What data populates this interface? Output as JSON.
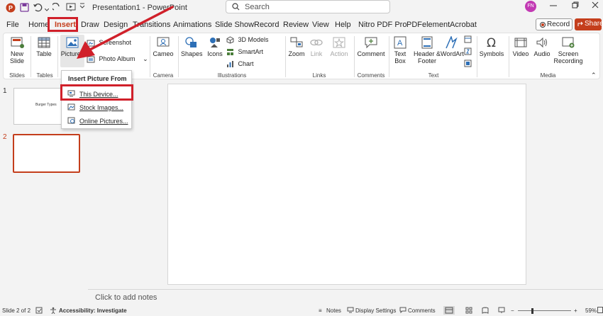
{
  "window": {
    "title": "Presentation1  -  PowerPoint",
    "search_placeholder": "Search",
    "user_initials": "FN"
  },
  "tabs": [
    "File",
    "Home",
    "Insert",
    "Draw",
    "Design",
    "Transitions",
    "Animations",
    "Slide Show",
    "Record",
    "Review",
    "View",
    "Help",
    "Nitro PDF Pro",
    "PDFelement",
    "Acrobat"
  ],
  "active_tab": "Insert",
  "header_buttons": {
    "record": "Record",
    "share": "Share"
  },
  "ribbon": {
    "new_slide": "New Slide",
    "table": "Table",
    "pictures": "Pictures",
    "screenshot": "Screenshot",
    "photo_album": "Photo Album",
    "cameo": "Cameo",
    "shapes": "Shapes",
    "icons": "Icons",
    "models_3d": "3D Models",
    "smartart": "SmartArt",
    "chart": "Chart",
    "zoom": "Zoom",
    "link": "Link",
    "action": "Action",
    "comment": "Comment",
    "text_box": "Text Box",
    "header_footer": "Header & Footer",
    "wordart": "WordArt",
    "symbols": "Symbols",
    "video": "Video",
    "audio": "Audio",
    "screen_recording": "Screen Recording",
    "groups": {
      "slides": "Slides",
      "tables": "Tables",
      "camera": "Camera",
      "illustrations": "Illustrations",
      "links": "Links",
      "comments": "Comments",
      "text": "Text",
      "media": "Media"
    }
  },
  "dropdown": {
    "header": "Insert Picture From",
    "items": [
      "This Device...",
      "Stock Images...",
      "Online Pictures..."
    ]
  },
  "slides": [
    {
      "number": "1",
      "title": "Burger Types"
    },
    {
      "number": "2",
      "title": ""
    }
  ],
  "notes_placeholder": "Click to add notes",
  "status": {
    "slide_info": "Slide 2 of 2",
    "accessibility": "Accessibility: Investigate",
    "notes": "Notes",
    "display_settings": "Display Settings",
    "comments": "Comments",
    "zoom_level": "59%"
  },
  "colors": {
    "accent": "#c43e1c",
    "annotation": "#d0202a"
  }
}
